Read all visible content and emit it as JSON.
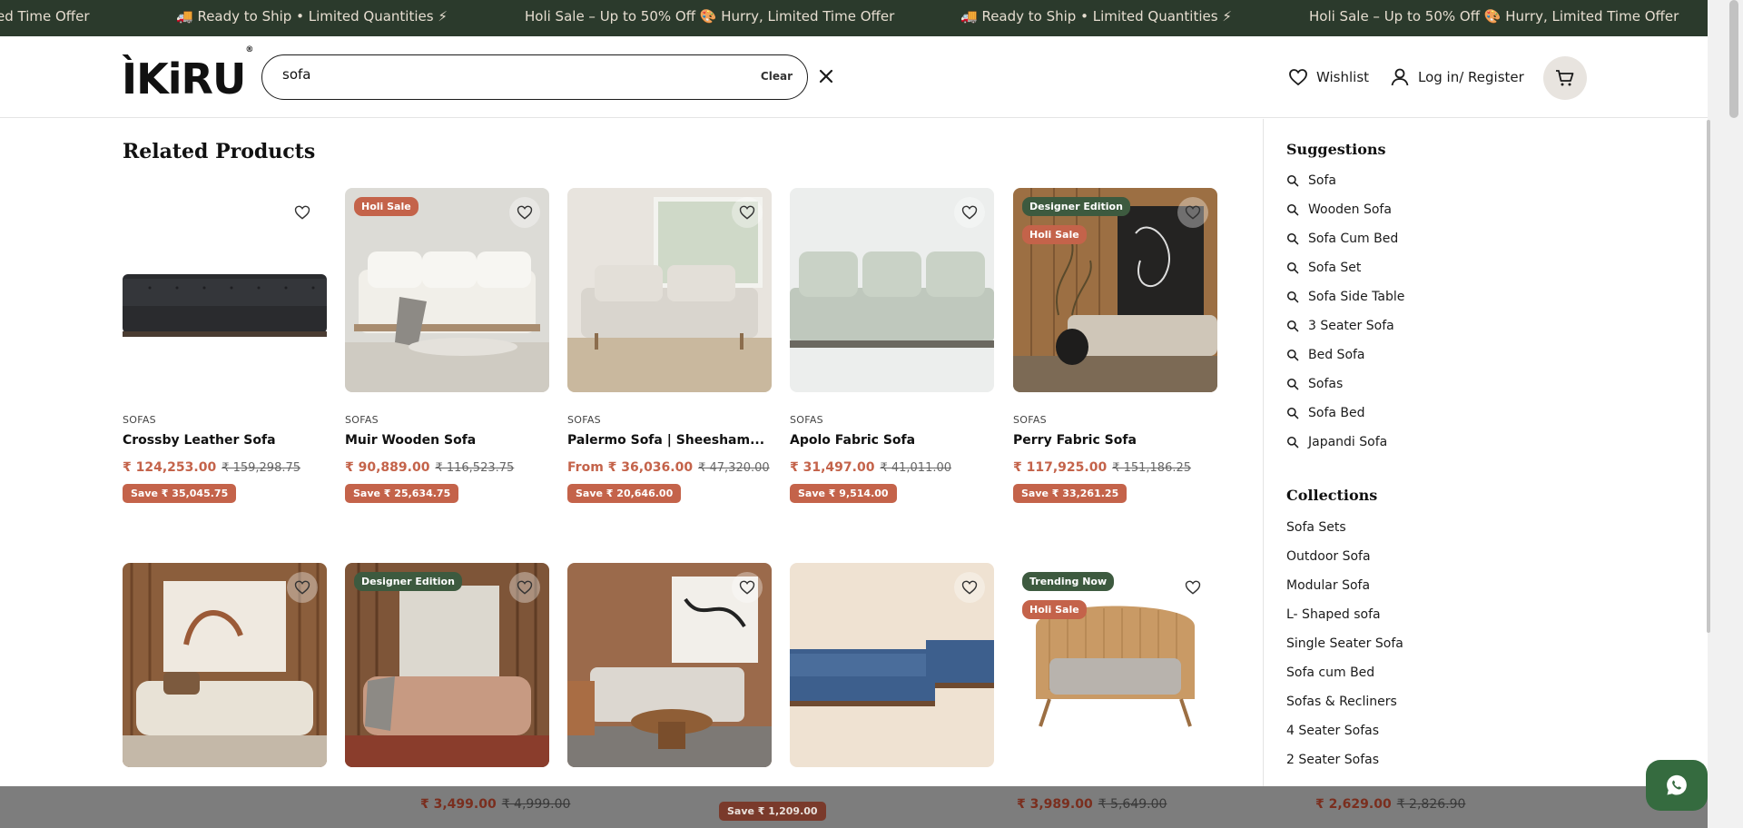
{
  "announcement": {
    "items": [
      "ed Time Offer",
      "🚚 Ready to Ship • Limited Quantities ⚡",
      "Holi Sale – Up to 50% Off 🎨 Hurry, Limited Time Offer",
      "🚚 Ready to Ship • Limited Quantities ⚡",
      "Holi Sale – Up to 50% Off 🎨 Hurry, Limited Time Offer"
    ]
  },
  "header": {
    "logo_text": "ÌKiRU",
    "logo_mark": "®",
    "search_value": "sofa",
    "clear_label": "Clear",
    "wishlist_label": "Wishlist",
    "login_label": "Log in/ Register"
  },
  "related": {
    "title": "Related Products",
    "products": [
      {
        "category": "SOFAS",
        "name": "Crossby Leather Sofa",
        "price": "₹ 124,253.00",
        "mrp": "₹ 159,298.75",
        "save": "Save ₹ 35,045.75",
        "badges": []
      },
      {
        "category": "SOFAS",
        "name": "Muir Wooden Sofa",
        "price": "₹ 90,889.00",
        "mrp": "₹ 116,523.75",
        "save": "Save ₹ 25,634.75",
        "badges": [
          {
            "text": "Holi Sale",
            "kind": "sale"
          }
        ]
      },
      {
        "category": "SOFAS",
        "name": "Palermo Sofa | Sheesham...",
        "price": "From ₹ 36,036.00",
        "mrp": "₹ 47,320.00",
        "save": "Save ₹ 20,646.00",
        "badges": []
      },
      {
        "category": "SOFAS",
        "name": "Apolo Fabric Sofa",
        "price": "₹ 31,497.00",
        "mrp": "₹ 41,011.00",
        "save": "Save ₹ 9,514.00",
        "badges": []
      },
      {
        "category": "SOFAS",
        "name": "Perry Fabric Sofa",
        "price": "₹ 117,925.00",
        "mrp": "₹ 151,186.25",
        "save": "Save ₹ 33,261.25",
        "badges": [
          {
            "text": "Designer Edition",
            "kind": "green"
          },
          {
            "text": "Holi Sale",
            "kind": "sale"
          }
        ]
      }
    ],
    "second_row_badges": [
      [],
      [
        {
          "text": "Designer Edition",
          "kind": "green"
        }
      ],
      [],
      [],
      [
        {
          "text": "Trending Now",
          "kind": "green"
        },
        {
          "text": "Holi Sale",
          "kind": "sale"
        }
      ]
    ]
  },
  "suggestions": {
    "title": "Suggestions",
    "items": [
      "Sofa",
      "Wooden Sofa",
      "Sofa Cum Bed",
      "Sofa Set",
      "Sofa Side Table",
      "3 Seater Sofa",
      "Bed Sofa",
      "Sofas",
      "Sofa Bed",
      "Japandi Sofa"
    ]
  },
  "collections": {
    "title": "Collections",
    "items": [
      "Sofa Sets",
      "Outdoor Sofa",
      "Modular Sofa",
      "L- Shaped sofa",
      "Single Seater Sofa",
      "Sofa cum Bed",
      "Sofas & Recliners",
      "4 Seater Sofas",
      "2 Seater Sofas"
    ]
  },
  "background_prices": [
    {
      "price": "₹ 3,499.00",
      "mrp": "₹ 4,999.00"
    },
    {
      "save": "Save ₹ 1,209.00"
    },
    {
      "price": "₹ 3,989.00",
      "mrp": "₹ 5,649.00"
    },
    {
      "price": "₹ 2,629.00",
      "mrp": "₹ 2,826.90"
    }
  ],
  "colors": {
    "announcement_bg": "#2b3a2c",
    "accent_price": "#c4634a",
    "badge_green": "#3d5a3f",
    "whatsapp_bg": "#356b3f"
  }
}
